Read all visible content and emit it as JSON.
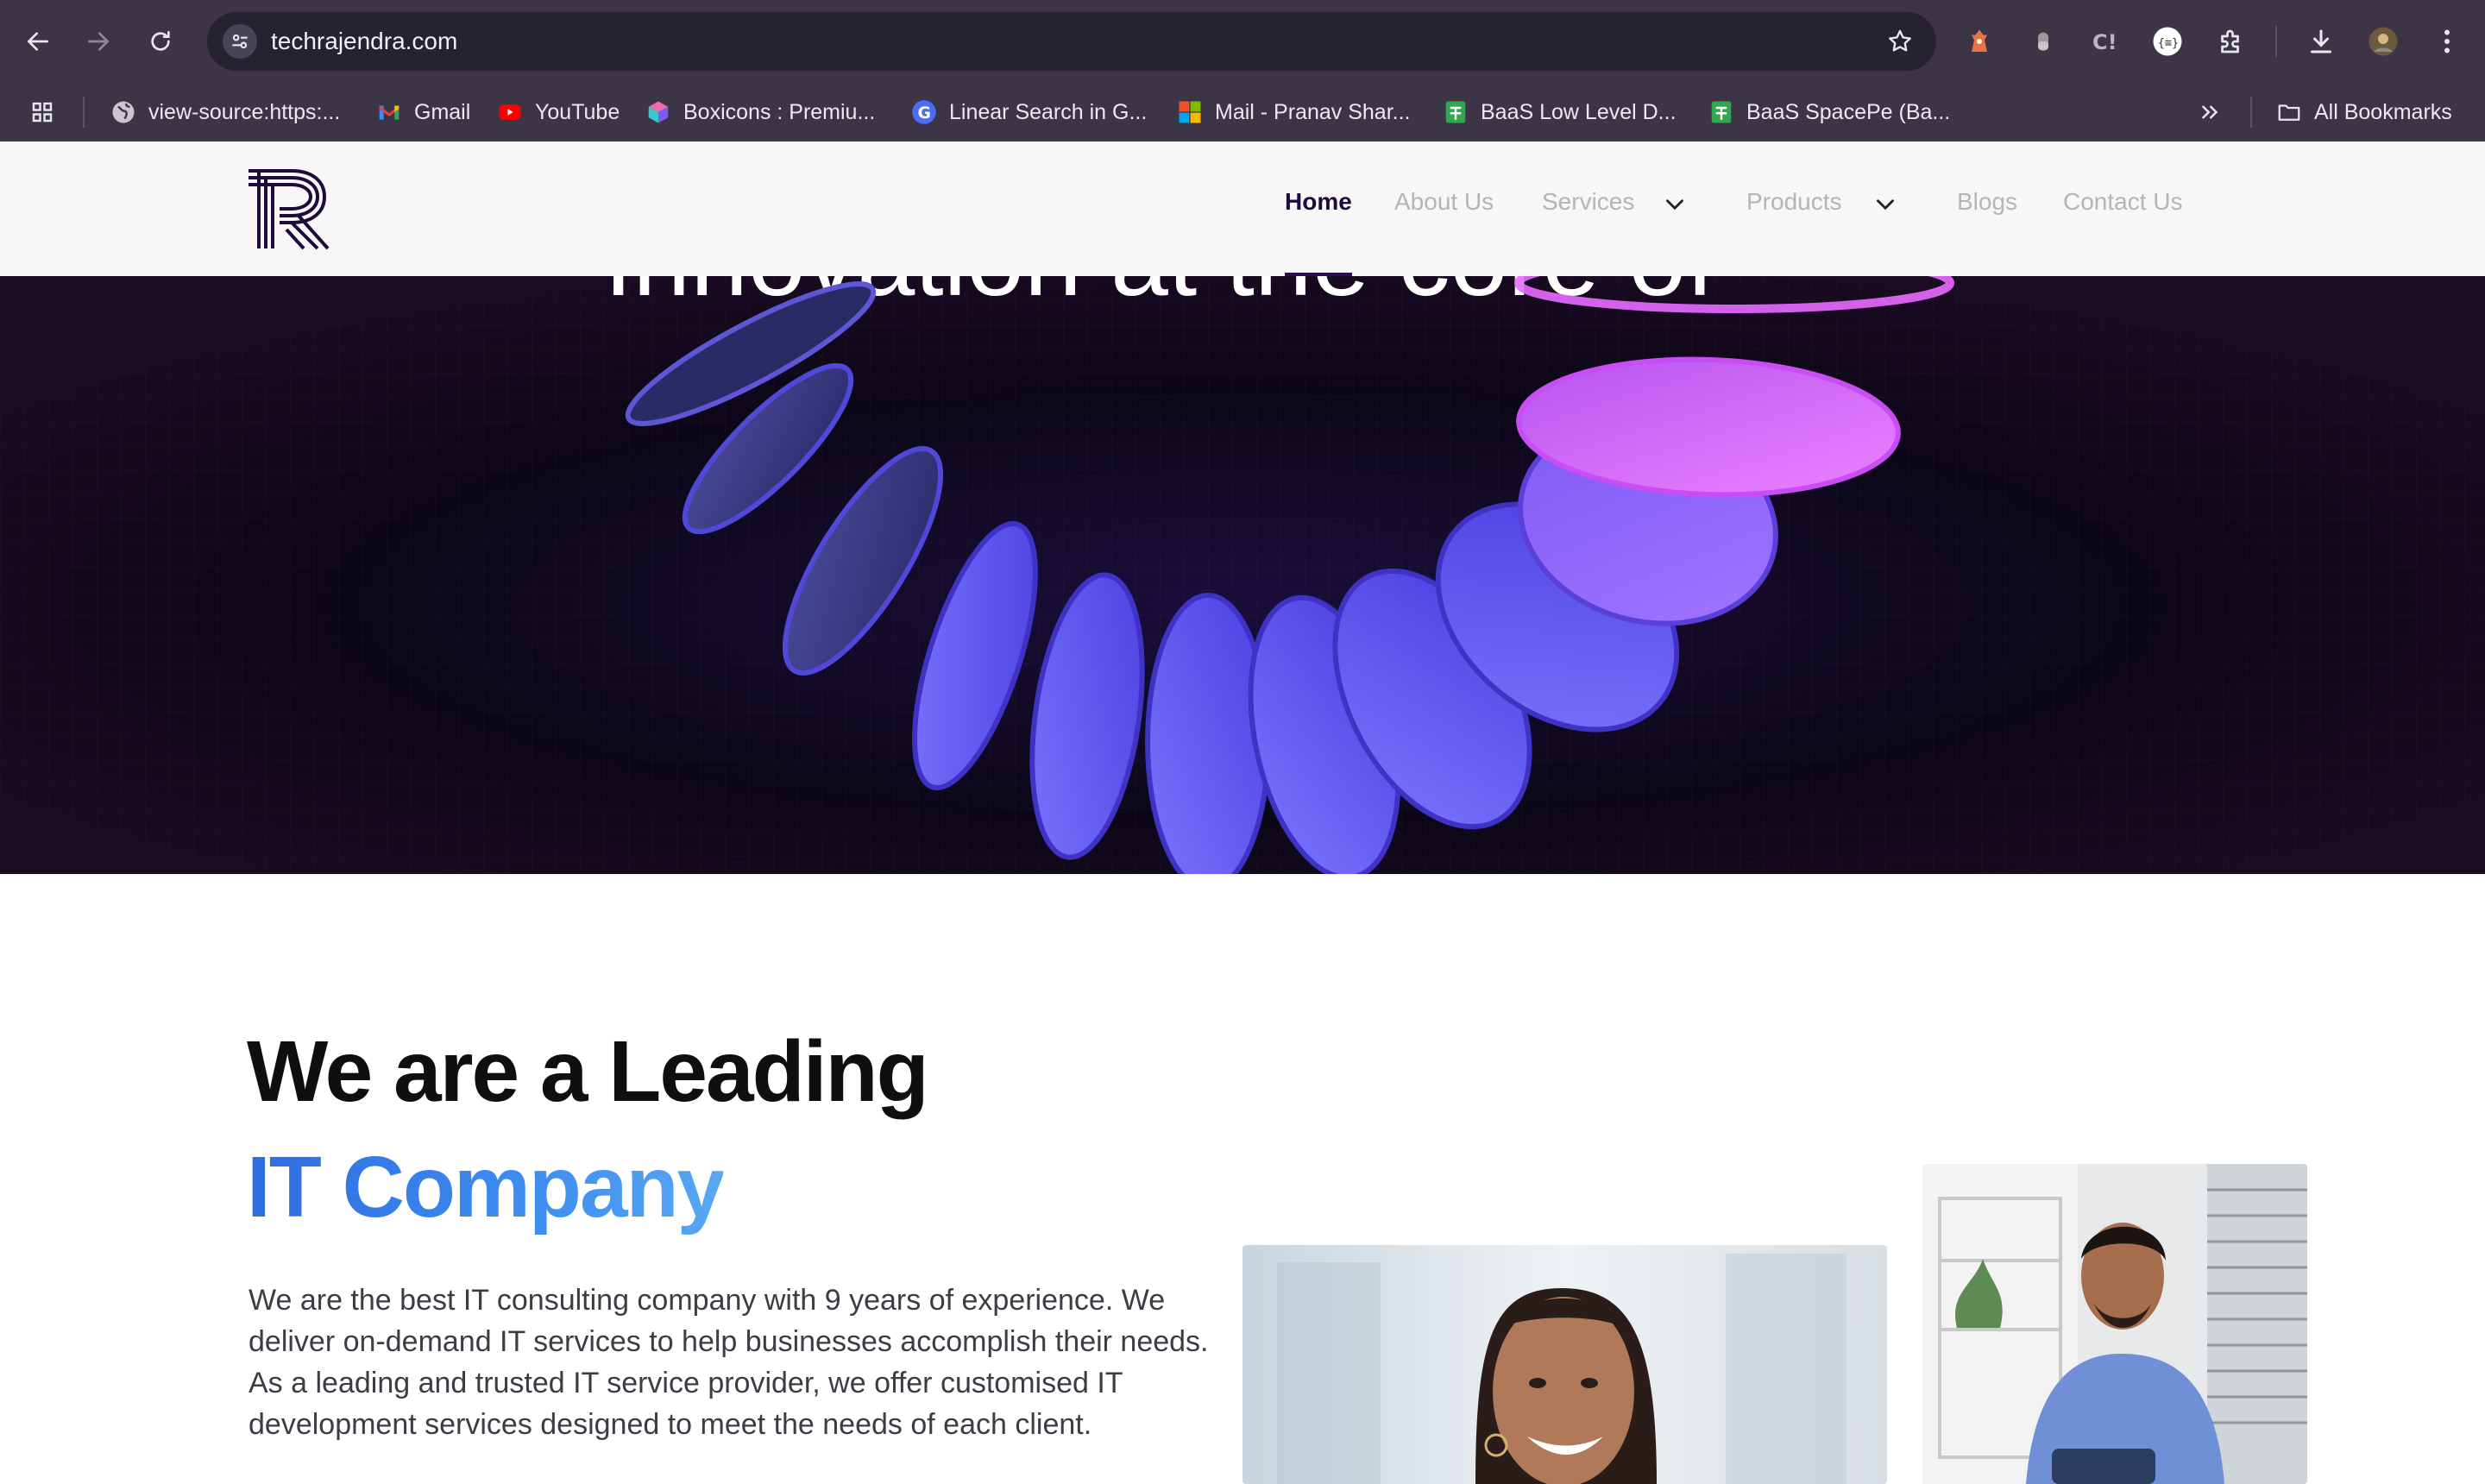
{
  "browser": {
    "url": "techrajendra.com",
    "bookmarks": [
      {
        "label": "view-source:https:...",
        "icon": "globe-icon"
      },
      {
        "label": "Gmail",
        "icon": "gmail-icon"
      },
      {
        "label": "YouTube",
        "icon": "youtube-icon"
      },
      {
        "label": "Boxicons : Premiu...",
        "icon": "boxicons-icon"
      },
      {
        "label": "Linear Search in G...",
        "icon": "google-icon"
      },
      {
        "label": "Mail - Pranav Shar...",
        "icon": "microsoft-icon"
      },
      {
        "label": "BaaS Low Level D...",
        "icon": "sheets-icon"
      },
      {
        "label": "BaaS SpacePe (Ba...",
        "icon": "sheets-icon"
      }
    ],
    "all_bookmarks": "All Bookmarks"
  },
  "site": {
    "nav": {
      "home": "Home",
      "about": "About Us",
      "services": "Services",
      "products": "Products",
      "blogs": "Blogs",
      "contact": "Contact Us"
    },
    "hero": {
      "heading_partial": "Innovation at the core of"
    },
    "about": {
      "heading_line1": "We are a Leading",
      "heading_line2": "IT Company",
      "paragraph": "We are the best IT consulting company with 9 years of experience. We deliver on-demand IT services to help businesses accomplish their needs. As a leading and trusted IT service provider, we offer customised IT development services designed to meet the needs of each client."
    }
  },
  "colors": {
    "accent_blue": "#2f6ce0",
    "nav_active": "#1b0c3d",
    "hero_purple": "#6a5cff",
    "hero_pink": "#e066ff"
  }
}
